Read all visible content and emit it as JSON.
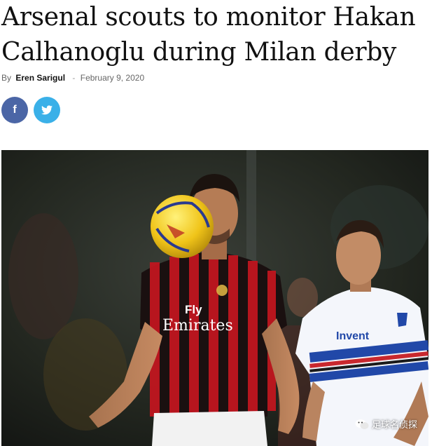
{
  "article": {
    "title": "Arsenal scouts to monitor Hakan Calhanoglu during Milan derby",
    "by_label": "By",
    "author": "Eren Sarigul",
    "separator": "-",
    "date": "February 9, 2020"
  },
  "share": {
    "facebook_glyph": "f",
    "twitter_icon": "twitter-icon",
    "facebook_color": "#4b66a6",
    "twitter_color": "#3ab0e8"
  },
  "photo": {
    "jersey_sponsor_line1": "Fly",
    "jersey_sponsor_line2": "Emirates",
    "opponent_sponsor": "Invent",
    "watermark": "足球名侦探"
  }
}
